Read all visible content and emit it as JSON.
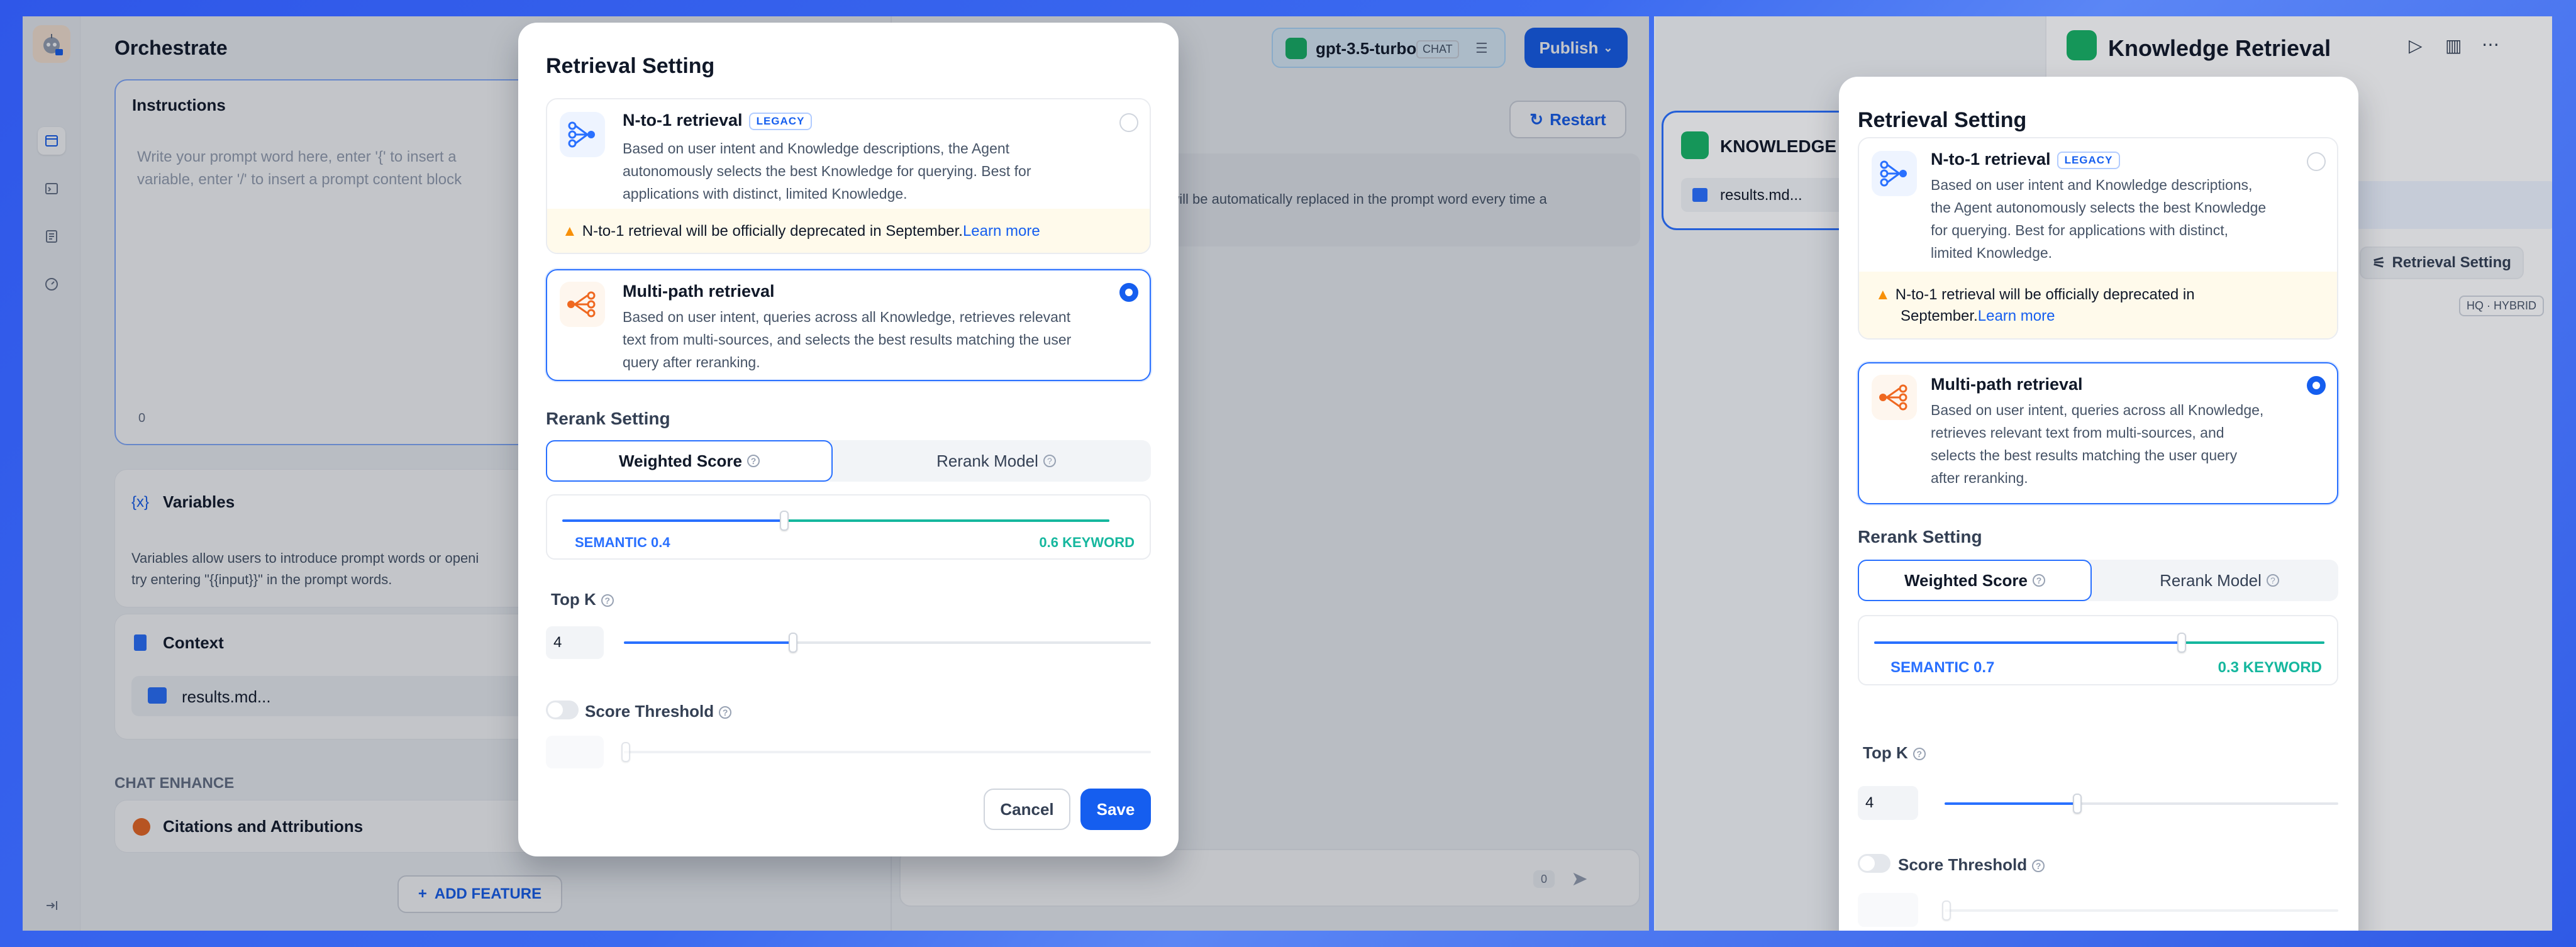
{
  "left": {
    "app_title": "Orchestrate",
    "model": {
      "name": "gpt-3.5-turbo",
      "mode": "CHAT"
    },
    "publish_label": "Publish",
    "restart_label": "Restart",
    "instructions": {
      "title": "Instructions",
      "placeholder": "Write your prompt word here, enter '{' to insert a variable, enter '/' to insert a prompt content block",
      "count": "0"
    },
    "debug_hint": "ch will be automatically replaced in the prompt word every time a",
    "variables": {
      "title": "Variables",
      "desc_line1": "Variables allow users to introduce prompt words or openi",
      "desc_line2": "try entering \"{{input}}\" in the prompt words."
    },
    "context": {
      "title": "Context",
      "file": "results.md..."
    },
    "chat_enhance": {
      "heading": "CHAT ENHANCE",
      "citations": "Citations and Attributions"
    },
    "add_feature": "ADD FEATURE",
    "chat_count": "0"
  },
  "modal_left": {
    "title": "Retrieval Setting",
    "n1": {
      "title": "N-to-1 retrieval",
      "badge": "LEGACY",
      "desc_lines": [
        "Based on user intent and Knowledge descriptions, the Agent",
        "autonomously selects the best Knowledge for querying. Best for",
        "applications with distinct, limited Knowledge."
      ],
      "selected": false
    },
    "warning": {
      "text": "N-to-1 retrieval will be officially deprecated in September.",
      "link": "Learn more"
    },
    "multi": {
      "title": "Multi-path retrieval",
      "desc_lines": [
        "Based on user intent, queries across all Knowledge, retrieves relevant",
        "text from multi-sources, and selects the best results matching the user",
        "query after reranking."
      ],
      "selected": true
    },
    "rerank_title": "Rerank Setting",
    "tabs": {
      "weighted": "Weighted Score",
      "model": "Rerank Model",
      "active": "weighted"
    },
    "weights": {
      "semantic_label": "SEMANTIC 0.4",
      "keyword_label": "0.6 KEYWORD",
      "semantic": 0.4,
      "keyword": 0.6
    },
    "topk": {
      "label": "Top K",
      "value": "4",
      "level": 0.34
    },
    "threshold": {
      "label": "Score Threshold",
      "enabled": false
    },
    "cancel": "Cancel",
    "save": "Save"
  },
  "right": {
    "node_title": "Knowledge Retrieval",
    "node_tag": "KNOWLEDGE",
    "node_file": "results.md...",
    "retrieval_setting_btn": "Retrieval Setting",
    "hq_tag": "HQ · HYBRID"
  },
  "modal_right": {
    "title": "Retrieval Setting",
    "n1": {
      "title": "N-to-1 retrieval",
      "badge": "LEGACY",
      "desc_lines": [
        "Based on user intent and Knowledge descriptions,",
        "the Agent autonomously selects the best Knowledge",
        "for querying. Best for applications with distinct,",
        "limited Knowledge."
      ],
      "selected": false
    },
    "warning": {
      "line1": "N-to-1 retrieval will be officially deprecated in",
      "line2": "September.",
      "link": "Learn more"
    },
    "multi": {
      "title": "Multi-path retrieval",
      "desc_lines": [
        "Based on user intent, queries across all Knowledge,",
        "retrieves relevant text from multi-sources, and",
        "selects the best results matching the user query",
        "after reranking."
      ],
      "selected": true
    },
    "rerank_title": "Rerank Setting",
    "tabs": {
      "weighted": "Weighted Score",
      "model": "Rerank Model",
      "active": "weighted"
    },
    "weights": {
      "semantic_label": "SEMANTIC 0.7",
      "keyword_label": "0.3 KEYWORD",
      "semantic": 0.7,
      "keyword": 0.3
    },
    "topk": {
      "label": "Top K",
      "value": "4",
      "level": 0.34
    },
    "threshold": {
      "label": "Score Threshold",
      "enabled": false
    }
  },
  "colors": {
    "accent": "#155eef",
    "green": "#16b364",
    "teal": "#15b79e",
    "warning": "#f79009",
    "orange": "#ef6820"
  }
}
